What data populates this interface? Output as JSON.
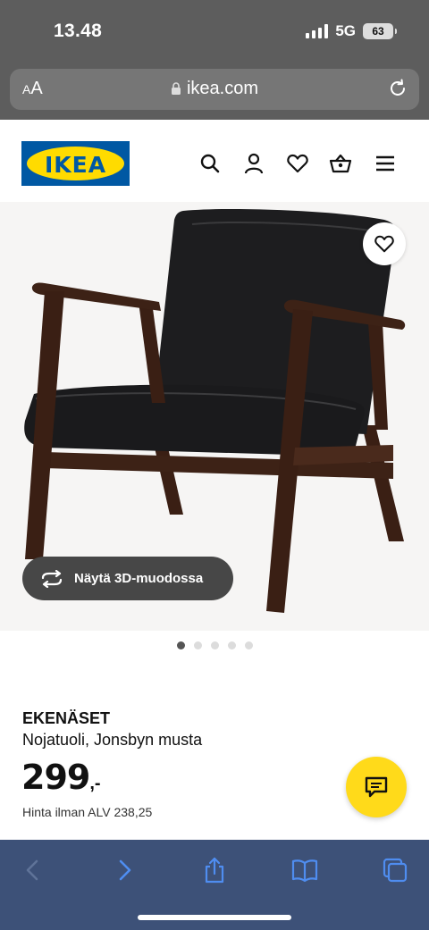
{
  "status_bar": {
    "time": "13.48",
    "network": "5G",
    "battery": "63"
  },
  "browser": {
    "text_size_label_small": "A",
    "text_size_label_large": "A",
    "url": "ikea.com"
  },
  "header": {
    "logo_text": "IKEA",
    "icons": [
      "search-icon",
      "account-icon",
      "heart-icon",
      "basket-icon",
      "menu-icon"
    ]
  },
  "product": {
    "view_3d_label": "Näytä 3D-muodossa",
    "carousel": {
      "total": 5,
      "active": 1
    },
    "name": "EKENÄSET",
    "description": "Nojatuoli, Jonsbyn musta",
    "price_main": "299",
    "price_suffix": ",-",
    "vat_text": "Hinta ilman ALV 238,25"
  },
  "toolbar": {
    "icons": [
      "back-icon",
      "forward-icon",
      "share-icon",
      "bookmarks-icon",
      "tabs-icon"
    ]
  },
  "colors": {
    "ikea_blue": "#0058a3",
    "ikea_yellow": "#ffdb00",
    "toolbar_bg": "#3d5178",
    "chrome_bg": "#5d5d5d"
  }
}
